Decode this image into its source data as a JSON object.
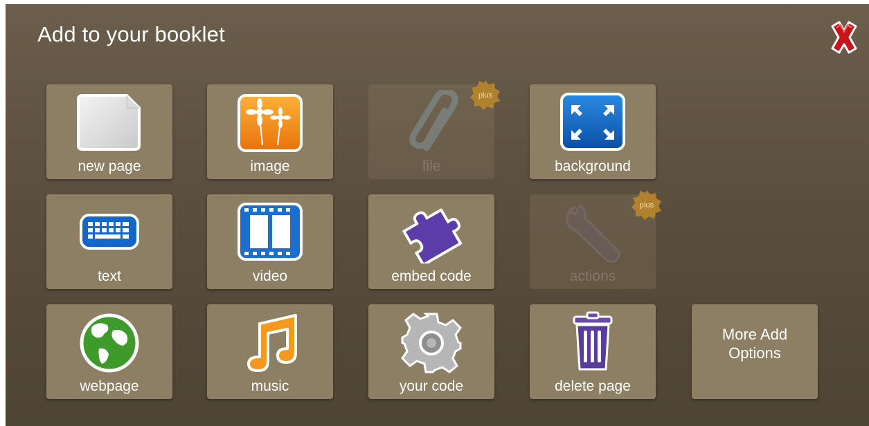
{
  "dialog": {
    "title": "Add to your booklet"
  },
  "tiles": [
    {
      "label": "new page"
    },
    {
      "label": "image"
    },
    {
      "label": "file",
      "badge": "plus"
    },
    {
      "label": "background"
    },
    {
      "label": "text"
    },
    {
      "label": "video"
    },
    {
      "label": "embed code"
    },
    {
      "label": "actions",
      "badge": "plus"
    },
    {
      "label": "webpage"
    },
    {
      "label": "music"
    },
    {
      "label": "your code"
    },
    {
      "label": "delete page"
    },
    {
      "label_line1": "More Add",
      "label_line2": "Options"
    }
  ],
  "icons": {
    "close": "close-x-icon",
    "new_page": "blank-page-icon",
    "image": "flowers-image-icon",
    "file": "paperclip-icon",
    "background": "expand-arrows-icon",
    "text": "keyboard-icon",
    "video": "film-strip-icon",
    "embed": "puzzle-piece-icon",
    "actions": "wrench-icon",
    "webpage": "globe-icon",
    "music": "music-note-icon",
    "your_code": "gear-icon",
    "delete": "trash-can-icon"
  },
  "colors": {
    "panel": "#5c503f",
    "tile": "#8c7f63",
    "close_red": "#c8151c",
    "plus_badge": "#b8862a"
  }
}
